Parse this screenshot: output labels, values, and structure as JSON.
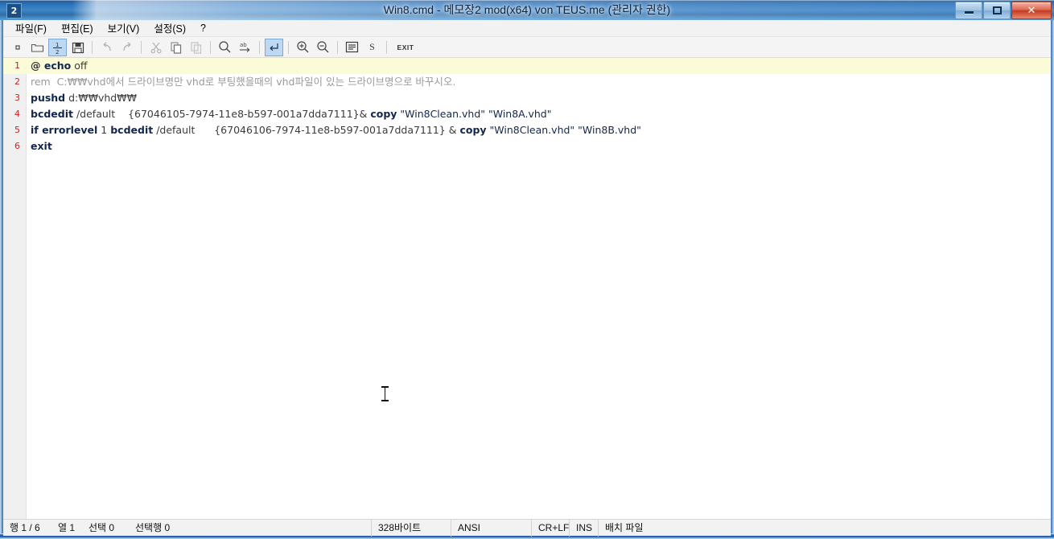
{
  "window": {
    "badge": "2",
    "title": "Win8.cmd - 메모장2 mod(x64) von TEUS.me (관리자 권한)",
    "controls": {
      "minimize": "minimize",
      "maximize": "maximize",
      "close": "✕"
    }
  },
  "menubar": {
    "items": [
      {
        "label": "파일(F)",
        "name": "menu-file"
      },
      {
        "label": "편집(E)",
        "name": "menu-edit"
      },
      {
        "label": "보기(V)",
        "name": "menu-view"
      },
      {
        "label": "설정(S)",
        "name": "menu-settings"
      },
      {
        "label": "?",
        "name": "menu-help"
      }
    ]
  },
  "toolbar": {
    "items": [
      {
        "name": "new-file-icon",
        "kind": "icon",
        "label": ""
      },
      {
        "name": "open-folder-icon",
        "kind": "icon",
        "label": ""
      },
      {
        "name": "line-numbers-icon",
        "kind": "icon",
        "label": "",
        "active": true
      },
      {
        "name": "save-icon",
        "kind": "icon",
        "label": ""
      },
      {
        "name": "undo-icon",
        "kind": "icon",
        "label": ""
      },
      {
        "name": "redo-icon",
        "kind": "icon",
        "label": ""
      },
      {
        "name": "cut-icon",
        "kind": "icon",
        "label": ""
      },
      {
        "name": "copy-icon",
        "kind": "icon",
        "label": ""
      },
      {
        "name": "paste-icon",
        "kind": "icon",
        "label": ""
      },
      {
        "name": "search-icon",
        "kind": "icon",
        "label": ""
      },
      {
        "name": "replace-icon",
        "kind": "icon",
        "label": "ab"
      },
      {
        "name": "word-wrap-icon",
        "kind": "icon",
        "label": "",
        "active": true
      },
      {
        "name": "zoom-in-icon",
        "kind": "icon",
        "label": ""
      },
      {
        "name": "zoom-out-icon",
        "kind": "icon",
        "label": ""
      },
      {
        "name": "format-list-icon",
        "kind": "icon",
        "label": ""
      },
      {
        "name": "style-s-icon",
        "kind": "text",
        "label": "S"
      },
      {
        "name": "exit-button",
        "kind": "text",
        "label": "EXIT"
      }
    ]
  },
  "editor": {
    "current_line": 1,
    "lines": [
      {
        "number": "1",
        "tokens": [
          {
            "t": "@",
            "c": "sym"
          },
          {
            "t": " echo",
            "c": "kw"
          },
          {
            "t": " off",
            "c": "plain"
          }
        ]
      },
      {
        "number": "2",
        "tokens": [
          {
            "t": "rem  C:₩₩vhd에서 드라이브명만 vhd로 부팅했을때의 vhd파일이 있는 드라이브명으로 바꾸시오.",
            "c": "cmt"
          }
        ]
      },
      {
        "number": "3",
        "tokens": [
          {
            "t": "pushd",
            "c": "kw"
          },
          {
            "t": " d:₩₩vhd₩₩",
            "c": "plain"
          }
        ]
      },
      {
        "number": "4",
        "tokens": [
          {
            "t": "bcdedit",
            "c": "kw"
          },
          {
            "t": " /default    {67046105-7974-11e8-b597-001a7dda7111}& ",
            "c": "plain"
          },
          {
            "t": "copy",
            "c": "kw"
          },
          {
            "t": " \"Win8Clean.vhd\" \"Win8A.vhd\"",
            "c": "str"
          }
        ]
      },
      {
        "number": "5",
        "tokens": [
          {
            "t": "if errorlevel",
            "c": "kw"
          },
          {
            "t": " 1 ",
            "c": "plain"
          },
          {
            "t": "bcdedit",
            "c": "kw"
          },
          {
            "t": " /default      {67046106-7974-11e8-b597-001a7dda7111} & ",
            "c": "plain"
          },
          {
            "t": "copy",
            "c": "kw"
          },
          {
            "t": " \"Win8Clean.vhd\" \"Win8B.vhd\"",
            "c": "str"
          }
        ]
      },
      {
        "number": "6",
        "tokens": [
          {
            "t": "exit",
            "c": "kw"
          }
        ]
      }
    ]
  },
  "statusbar": {
    "line_info": "행 1 / 6",
    "column_info": "열 1",
    "selection_info": "선택 0",
    "selection_lines_info": "선택행 0",
    "size": "328바이트",
    "encoding": "ANSI",
    "line_ending": "CR+LF",
    "insert_mode": "INS",
    "file_type": "배치 파일"
  },
  "colors": {
    "title_gradient_start": "#1e5799",
    "close_button": "#c53a22",
    "current_line_highlight": "#fbfbd8",
    "line_number": "#cc2222",
    "keyword": "#12264f",
    "comment": "#9a9a9a"
  }
}
